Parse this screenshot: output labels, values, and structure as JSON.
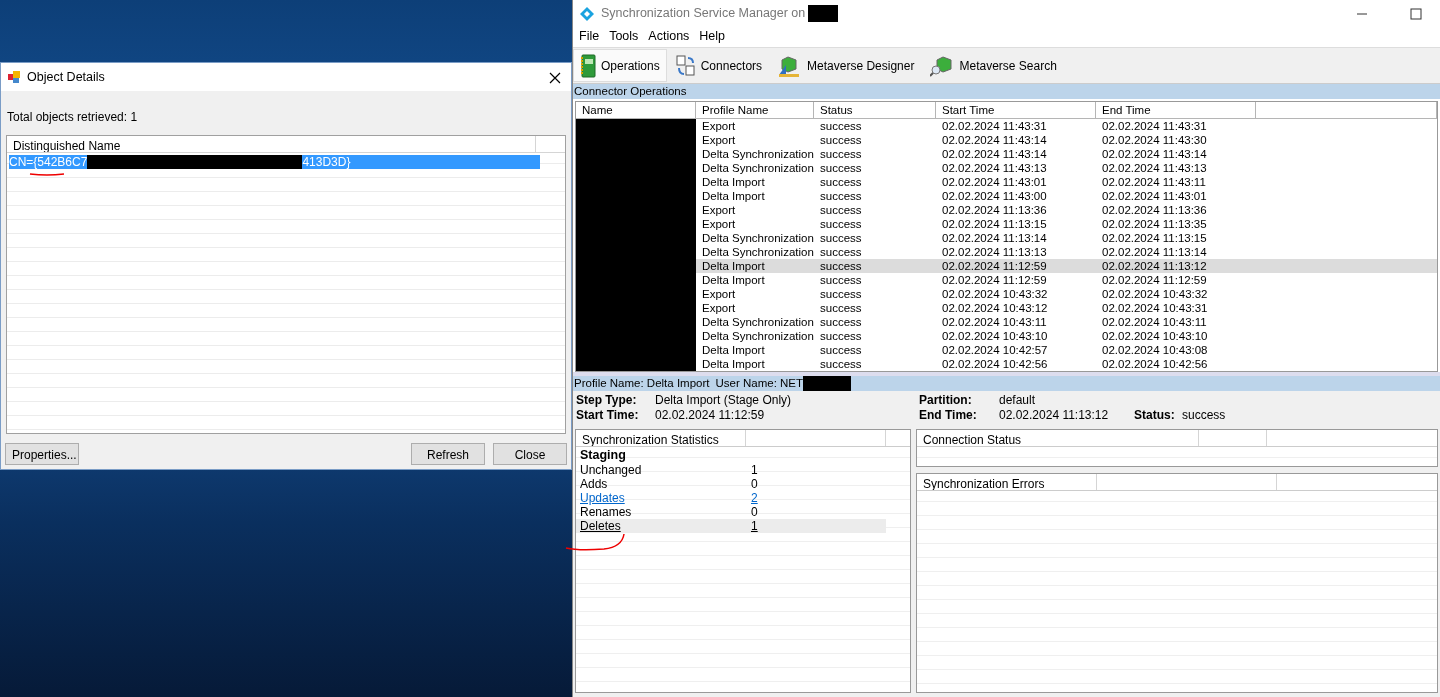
{
  "object_details": {
    "title": "Object Details",
    "summary": "Total objects retrieved: 1",
    "columns": [
      "Distinguished Name"
    ],
    "rows": [
      {
        "dn_parts": [
          "CN={542B6C7",
          "413D3D}"
        ],
        "selected": true
      }
    ],
    "buttons": [
      "Properties...",
      "Refresh",
      "Close"
    ]
  },
  "window": {
    "title": "Synchronization Service Manager on"
  },
  "menu": [
    "File",
    "Tools",
    "Actions",
    "Help"
  ],
  "toolbar": [
    {
      "label": "Operations",
      "kind": "operations",
      "selected": true
    },
    {
      "label": "Connectors",
      "kind": "connectors",
      "selected": false
    },
    {
      "label": "Metaverse Designer",
      "kind": "designer",
      "selected": false
    },
    {
      "label": "Metaverse Search",
      "kind": "search",
      "selected": false
    }
  ],
  "operations": {
    "title": "Connector Operations",
    "columns": [
      "Name",
      "Profile Name",
      "Status",
      "Start Time",
      "End Time"
    ],
    "rows": [
      {
        "profile": "Export",
        "status": "success",
        "start": "02.02.2024 11:43:31",
        "end": "02.02.2024 11:43:31",
        "selected": false
      },
      {
        "profile": "Export",
        "status": "success",
        "start": "02.02.2024 11:43:14",
        "end": "02.02.2024 11:43:30",
        "selected": false
      },
      {
        "profile": "Delta Synchronization",
        "status": "success",
        "start": "02.02.2024 11:43:14",
        "end": "02.02.2024 11:43:14",
        "selected": false
      },
      {
        "profile": "Delta Synchronization",
        "status": "success",
        "start": "02.02.2024 11:43:13",
        "end": "02.02.2024 11:43:13",
        "selected": false
      },
      {
        "profile": "Delta Import",
        "status": "success",
        "start": "02.02.2024 11:43:01",
        "end": "02.02.2024 11:43:11",
        "selected": false
      },
      {
        "profile": "Delta Import",
        "status": "success",
        "start": "02.02.2024 11:43:00",
        "end": "02.02.2024 11:43:01",
        "selected": false
      },
      {
        "profile": "Export",
        "status": "success",
        "start": "02.02.2024 11:13:36",
        "end": "02.02.2024 11:13:36",
        "selected": false
      },
      {
        "profile": "Export",
        "status": "success",
        "start": "02.02.2024 11:13:15",
        "end": "02.02.2024 11:13:35",
        "selected": false
      },
      {
        "profile": "Delta Synchronization",
        "status": "success",
        "start": "02.02.2024 11:13:14",
        "end": "02.02.2024 11:13:15",
        "selected": false
      },
      {
        "profile": "Delta Synchronization",
        "status": "success",
        "start": "02.02.2024 11:13:13",
        "end": "02.02.2024 11:13:14",
        "selected": false
      },
      {
        "profile": "Delta Import",
        "status": "success",
        "start": "02.02.2024 11:12:59",
        "end": "02.02.2024 11:13:12",
        "selected": true
      },
      {
        "profile": "Delta Import",
        "status": "success",
        "start": "02.02.2024 11:12:59",
        "end": "02.02.2024 11:12:59",
        "selected": false
      },
      {
        "profile": "Export",
        "status": "success",
        "start": "02.02.2024 10:43:32",
        "end": "02.02.2024 10:43:32",
        "selected": false
      },
      {
        "profile": "Export",
        "status": "success",
        "start": "02.02.2024 10:43:12",
        "end": "02.02.2024 10:43:31",
        "selected": false
      },
      {
        "profile": "Delta Synchronization",
        "status": "success",
        "start": "02.02.2024 10:43:11",
        "end": "02.02.2024 10:43:11",
        "selected": false
      },
      {
        "profile": "Delta Synchronization",
        "status": "success",
        "start": "02.02.2024 10:43:10",
        "end": "02.02.2024 10:43:10",
        "selected": false
      },
      {
        "profile": "Delta Import",
        "status": "success",
        "start": "02.02.2024 10:42:57",
        "end": "02.02.2024 10:43:08",
        "selected": false
      },
      {
        "profile": "Delta Import",
        "status": "success",
        "start": "02.02.2024 10:42:56",
        "end": "02.02.2024 10:42:56",
        "selected": false
      }
    ]
  },
  "details": {
    "header": [
      {
        "label": "Profile Name:",
        "value": "Delta Import"
      },
      {
        "label": "User Name:",
        "value": "NET"
      }
    ],
    "fields": [
      {
        "label": "Step Type:",
        "value": "Delta Import (Stage Only)"
      },
      {
        "label": "Start Time:",
        "value": "02.02.2024 11:12:59"
      },
      {
        "label": "Partition:",
        "value": "default"
      },
      {
        "label": "End Time:",
        "value": "02.02.2024 11:13:12"
      },
      {
        "label": "Status:",
        "value": "success"
      }
    ]
  },
  "sync_statistics": {
    "title": "Synchronization Statistics",
    "rows": [
      {
        "kind": "group",
        "label": "Staging",
        "selected": false
      },
      {
        "kind": "plain",
        "label": "Unchanged",
        "value": "1",
        "selected": false
      },
      {
        "kind": "plain",
        "label": "Adds",
        "value": "0",
        "selected": false
      },
      {
        "kind": "link",
        "label": "Updates",
        "value": "2",
        "selected": false
      },
      {
        "kind": "plain",
        "label": "Renames",
        "value": "0",
        "selected": false
      },
      {
        "kind": "link",
        "label": "Deletes",
        "value": "1",
        "selected": true
      }
    ]
  },
  "connection_status": {
    "title": "Connection Status"
  },
  "sync_errors": {
    "title": "Synchronization Errors"
  }
}
